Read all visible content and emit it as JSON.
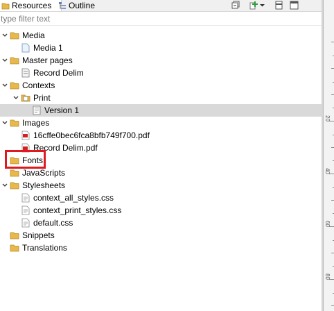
{
  "tabs": [
    {
      "label": "Resources",
      "icon": "folder-icon"
    },
    {
      "label": "Outline",
      "icon": "outline-icon"
    }
  ],
  "toolbar": {
    "icons": [
      "collapse-all-icon",
      "add-icon",
      "dropdown-icon",
      "minimize-icon",
      "maximize-icon"
    ]
  },
  "filter": {
    "placeholder": "type filter text",
    "value": ""
  },
  "tree": {
    "media": {
      "label": "Media",
      "children": {
        "media1": "Media 1"
      }
    },
    "master_pages": {
      "label": "Master pages",
      "children": {
        "record_delim": "Record Delim"
      }
    },
    "contexts": {
      "label": "Contexts",
      "print": {
        "label": "Print",
        "version1": "Version 1"
      }
    },
    "images": {
      "label": "Images",
      "children": {
        "pdf1": "16cffe0bec6fca8bfb749f700.pdf",
        "pdf2": "Record Delim.pdf"
      }
    },
    "fonts": {
      "label": "Fonts"
    },
    "javascripts": {
      "label": "JavaScripts"
    },
    "stylesheets": {
      "label": "Stylesheets",
      "children": {
        "css1": "context_all_styles.css",
        "css2": "context_print_styles.css",
        "css3": "default.css"
      }
    },
    "snippets": {
      "label": "Snippets"
    },
    "translations": {
      "label": "Translations"
    }
  },
  "selected_item": "Version 1",
  "highlighted_item": "Fonts",
  "ruler": {
    "labels": [
      "20",
      "40",
      "60",
      "80"
    ]
  },
  "colors": {
    "highlight": "#e0181f",
    "selection": "#d9d9d9",
    "folder": "#e8b84a"
  }
}
